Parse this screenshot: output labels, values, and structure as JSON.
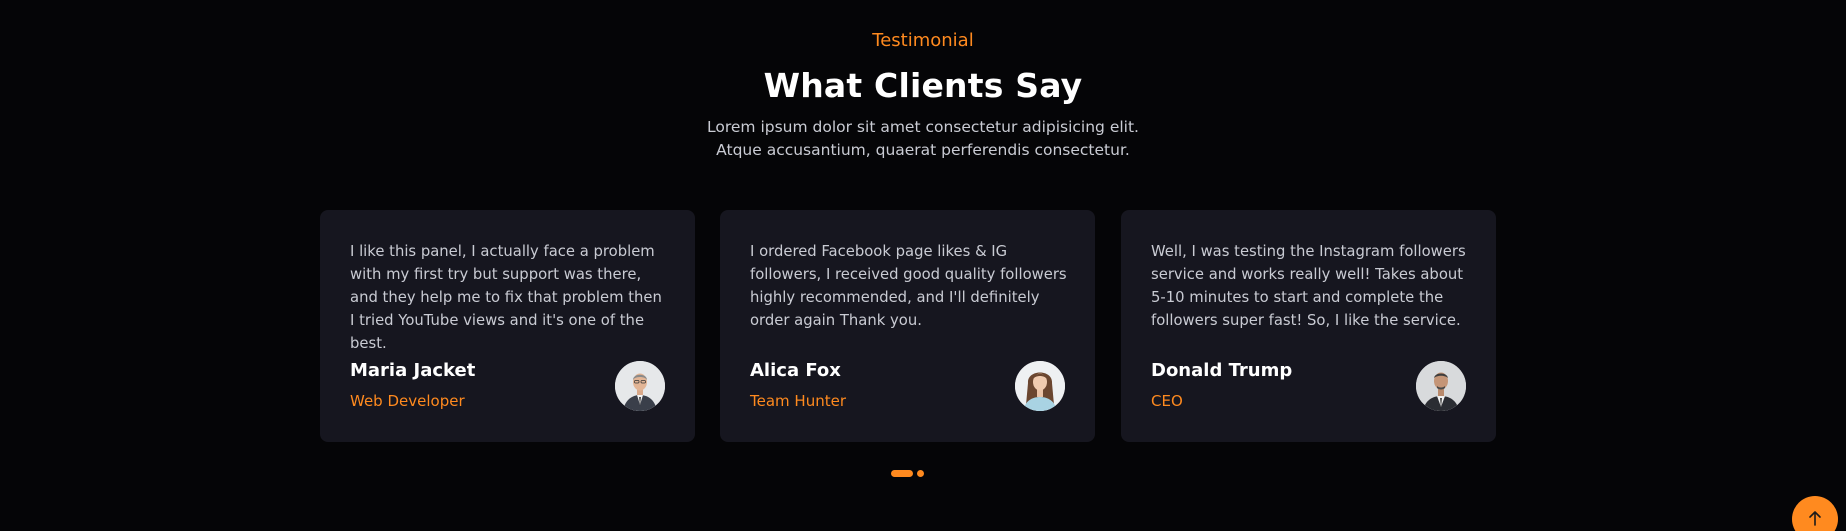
{
  "section": {
    "kicker": "Testimonial",
    "title": "What Clients Say",
    "subtitle": "Lorem ipsum dolor sit amet consectetur adipisicing elit. Atque accusantium, quaerat perferendis consectetur."
  },
  "testimonials": [
    {
      "text": "I like this panel, I actually face a problem with my first try but support was there, and they help me to fix that problem then I tried YouTube views and it's one of the best.",
      "name": "Maria Jacket",
      "role": "Web Developer",
      "avatar": "businessman-portrait"
    },
    {
      "text": "I ordered Facebook page likes & IG followers, I received good quality followers highly recommended, and I'll definitely order again Thank you.",
      "name": "Alica Fox",
      "role": "Team Hunter",
      "avatar": "woman-portrait"
    },
    {
      "text": "Well, I was testing the Instagram followers service and works really well! Takes about 5-10 minutes to start and complete the followers super fast! So, I like the service.",
      "name": "Donald Trump",
      "role": "CEO",
      "avatar": "man-suit-portrait"
    }
  ],
  "pagination": {
    "active_index": 0,
    "count": 2
  },
  "colors": {
    "accent": "#ff8a1f",
    "background": "#050507",
    "card": "#16161f"
  },
  "scroll_top": {
    "icon": "arrow-up-icon"
  }
}
